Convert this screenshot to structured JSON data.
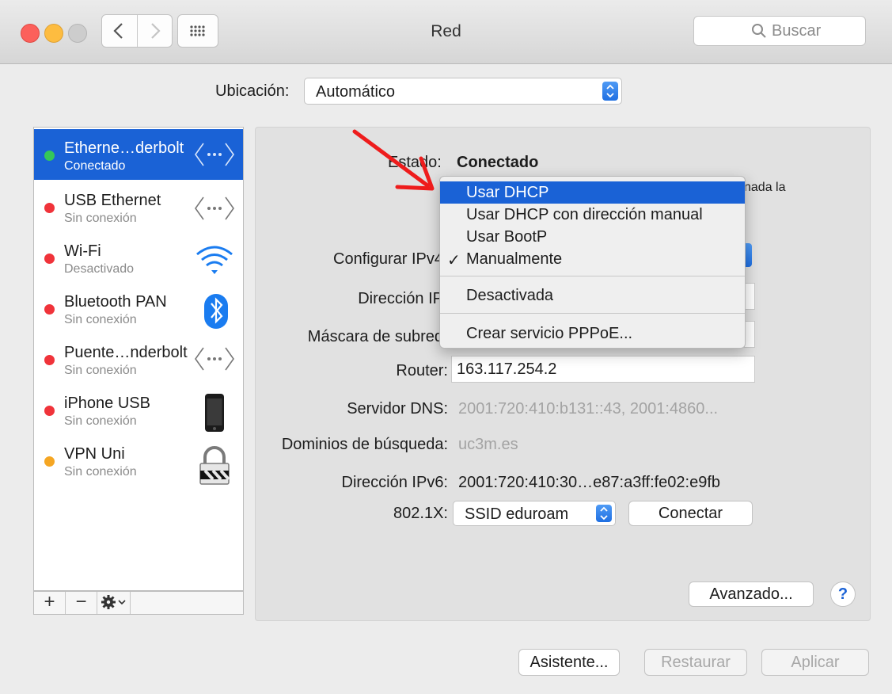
{
  "window": {
    "title": "Red",
    "search_placeholder": "Buscar",
    "traffic_colors": {
      "close": "#fc605b",
      "minimize": "#fdbc40",
      "zoom": "#c9c9c9"
    }
  },
  "location": {
    "label": "Ubicación:",
    "value": "Automático"
  },
  "sidebar": {
    "items": [
      {
        "name": "Etherne…derbolt",
        "status": "Conectado",
        "dot": "#35c759",
        "icon": "ethernet-icon"
      },
      {
        "name": "USB Ethernet",
        "status": "Sin conexión",
        "dot": "#f0333a",
        "icon": "ethernet-icon"
      },
      {
        "name": "Wi-Fi",
        "status": "Desactivado",
        "dot": "#f0333a",
        "icon": "wifi-icon"
      },
      {
        "name": "Bluetooth PAN",
        "status": "Sin conexión",
        "dot": "#f0333a",
        "icon": "bluetooth-icon"
      },
      {
        "name": "Puente…nderbolt",
        "status": "Sin conexión",
        "dot": "#f0333a",
        "icon": "ethernet-icon"
      },
      {
        "name": "iPhone USB",
        "status": "Sin conexión",
        "dot": "#f0333a",
        "icon": "iphone-icon"
      },
      {
        "name": "VPN Uni",
        "status": "Sin conexión",
        "dot": "#f5a623",
        "icon": "lock-icon"
      }
    ],
    "footer": {
      "add": "+",
      "remove": "−"
    }
  },
  "detail": {
    "estado_label": "Estado:",
    "estado_value": "Conectado",
    "partial_text": "nada la",
    "configure_label": "Configurar IPv4",
    "ip_label": "Dirección IP",
    "mask_label": "Máscara de subred",
    "router_label": "Router:",
    "router_value": "163.117.254.2",
    "dns_label": "Servidor DNS:",
    "dns_value": "2001:720:410:b131::43, 2001:4860...",
    "domains_label": "Dominios de búsqueda:",
    "domains_value": "uc3m.es",
    "ipv6_label": "Dirección IPv6:",
    "ipv6_value": "2001:720:410:30…e87:a3ff:fe02:e9fb",
    "x8021_label": "802.1X:",
    "x8021_value": "SSID eduroam",
    "connect_button": "Conectar",
    "advanced_button": "Avanzado...",
    "help_button": "?"
  },
  "menu": {
    "items": [
      {
        "label": "Usar DHCP",
        "highlighted": true
      },
      {
        "label": "Usar DHCP con dirección manual"
      },
      {
        "label": "Usar BootP"
      },
      {
        "label": "Manualmente",
        "checked": true
      },
      {
        "label": "Desactivada"
      },
      {
        "label": "Crear servicio PPPoE..."
      }
    ],
    "check_glyph": "✓"
  },
  "bottom": {
    "assistant": "Asistente...",
    "restore": "Restaurar",
    "apply": "Aplicar"
  },
  "annotation": {
    "arrow_color": "#ee1c1c"
  }
}
